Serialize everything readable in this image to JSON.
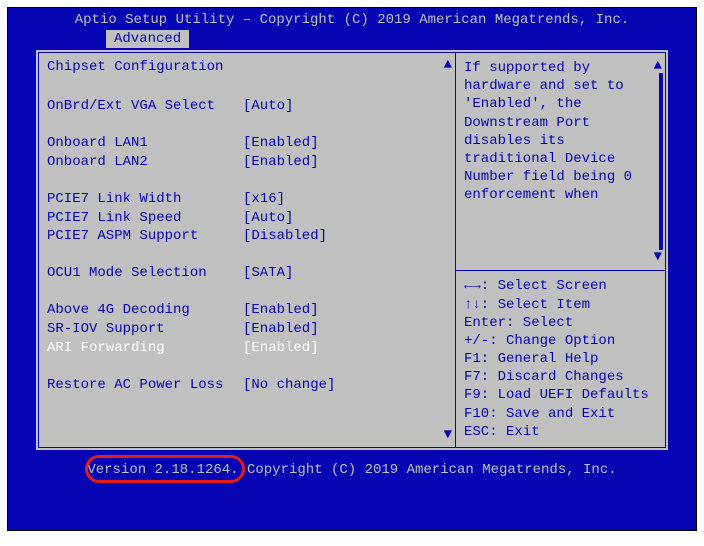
{
  "header": {
    "title": "Aptio Setup Utility – Copyright (C) 2019 American Megatrends, Inc."
  },
  "tabs": {
    "active": "Advanced"
  },
  "section_title": "Chipset Configuration",
  "settings": [
    {
      "label": "OnBrd/Ext VGA Select",
      "value": "[Auto]",
      "selected": false
    },
    {
      "blank": true
    },
    {
      "label": "Onboard LAN1",
      "value": "[Enabled]",
      "selected": false
    },
    {
      "label": "Onboard LAN2",
      "value": "[Enabled]",
      "selected": false
    },
    {
      "blank": true
    },
    {
      "label": "PCIE7 Link Width",
      "value": "[x16]",
      "selected": false
    },
    {
      "label": "PCIE7 Link Speed",
      "value": "[Auto]",
      "selected": false
    },
    {
      "label": "PCIE7 ASPM Support",
      "value": "[Disabled]",
      "selected": false
    },
    {
      "blank": true
    },
    {
      "label": "OCU1 Mode Selection",
      "value": "[SATA]",
      "selected": false
    },
    {
      "blank": true
    },
    {
      "label": "Above 4G Decoding",
      "value": "[Enabled]",
      "selected": false
    },
    {
      "label": "SR-IOV Support",
      "value": "[Enabled]",
      "selected": false
    },
    {
      "label": "ARI Forwarding",
      "value": "[Enabled]",
      "selected": true
    },
    {
      "blank": true
    },
    {
      "label": "Restore AC Power Loss",
      "value": "[No change]",
      "selected": false
    }
  ],
  "help_text": "If supported by hardware and set to 'Enabled', the Downstream Port disables its traditional Device Number field being 0 enforcement when",
  "key_hints": [
    "←→: Select Screen",
    "↑↓: Select Item",
    "Enter: Select",
    "+/-: Change Option",
    "F1: General Help",
    "F7: Discard Changes",
    "F9: Load UEFI Defaults",
    "F10: Save and Exit",
    "ESC: Exit"
  ],
  "footer": {
    "version": "Version 2.18.1264.",
    "copyright": " Copyright (C) 2019 American Megatrends, Inc."
  }
}
